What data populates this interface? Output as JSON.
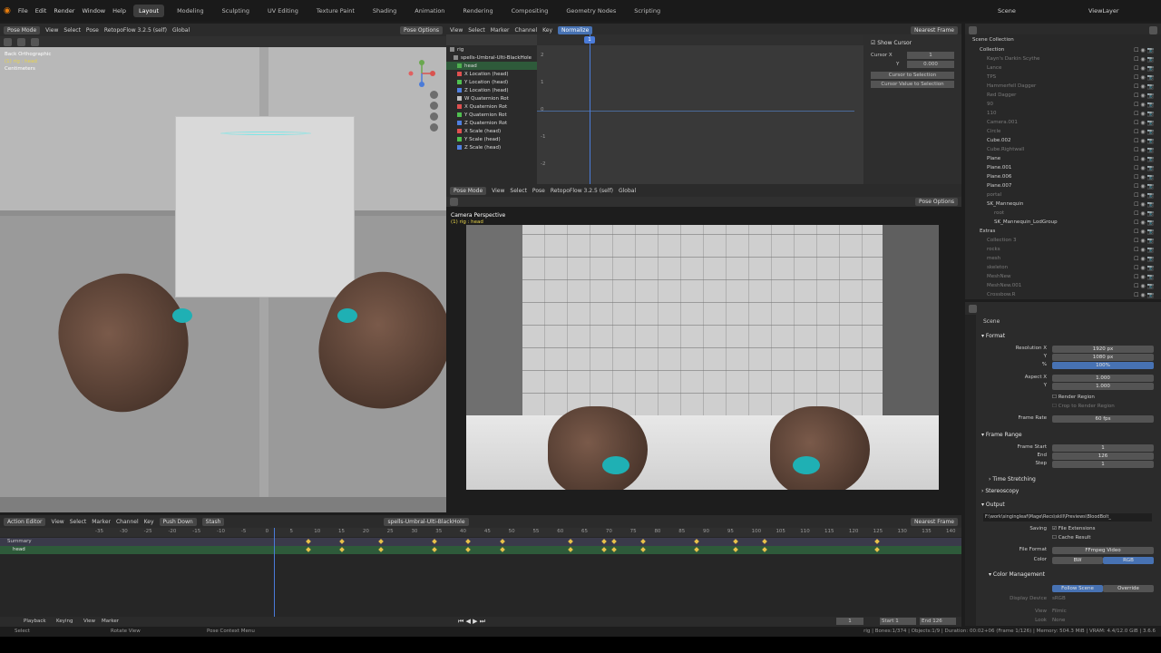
{
  "topbar": {
    "menus": [
      "File",
      "Edit",
      "Render",
      "Window",
      "Help"
    ],
    "workspaces": [
      "Layout",
      "Modeling",
      "Sculpting",
      "UV Editing",
      "Texture Paint",
      "Shading",
      "Animation",
      "Rendering",
      "Compositing",
      "Geometry Nodes",
      "Scripting"
    ],
    "active_workspace": "Layout",
    "scene": "Scene",
    "view_layer": "ViewLayer"
  },
  "viewport_left": {
    "mode": "Pose Mode",
    "menus": [
      "View",
      "Select",
      "Pose"
    ],
    "addon": "RetopoFlow 3.2.5 (self)",
    "transform": "Global",
    "pose_options": "Pose Options",
    "overlay_title": "Back Orthographic",
    "overlay_sub": "(1) rig : head",
    "overlay_unit": "Centimeters"
  },
  "graph_editor": {
    "menus": [
      "View",
      "Select",
      "Marker",
      "Channel",
      "Key"
    ],
    "normalize": "Normalize",
    "interp": "Nearest Frame",
    "ticks": [
      "-5",
      "0",
      "5",
      "10",
      "15",
      "20",
      "25",
      "30",
      "35",
      "40"
    ],
    "y_ticks": [
      "2",
      "1",
      "0",
      "-1",
      "-2"
    ],
    "current_frame": "1",
    "channels": [
      {
        "name": "rig",
        "color": "#8a8a8a"
      },
      {
        "name": "spells-Umbral-Ulti-BlackHole",
        "color": "#8a8a8a"
      },
      {
        "name": "head",
        "color": "#4fb04f"
      },
      {
        "name": "X Location (head)",
        "color": "#e05050"
      },
      {
        "name": "Y Location (head)",
        "color": "#50c050"
      },
      {
        "name": "Z Location (head)",
        "color": "#5080e0"
      },
      {
        "name": "W Quaternion Rot",
        "color": "#c0c0c0"
      },
      {
        "name": "X Quaternion Rot",
        "color": "#e05050"
      },
      {
        "name": "Y Quaternion Rot",
        "color": "#50c050"
      },
      {
        "name": "Z Quaternion Rot",
        "color": "#5080e0"
      },
      {
        "name": "X Scale (head)",
        "color": "#e05050"
      },
      {
        "name": "Y Scale (head)",
        "color": "#50c050"
      },
      {
        "name": "Z Scale (head)",
        "color": "#5080e0"
      }
    ]
  },
  "npanel": {
    "show_cursor": "Show Cursor",
    "cursor_x_label": "Cursor X",
    "cursor_x": "1",
    "y_label": "Y",
    "y_value": "0.000",
    "btn1": "Cursor to Selection",
    "btn2": "Cursor Value to Selection"
  },
  "camera_view": {
    "mode": "Pose Mode",
    "menus": [
      "View",
      "Select",
      "Pose"
    ],
    "addon": "RetopoFlow 3.2.5 (self)",
    "transform": "Global",
    "pose_options": "Pose Options",
    "title": "Camera Perspective",
    "sub": "(1) rig : head"
  },
  "outliner": {
    "title": "Scene Collection",
    "items": [
      {
        "name": "Collection",
        "level": 1,
        "dim": false
      },
      {
        "name": "Kayn's Darkin Scythe",
        "level": 2,
        "dim": true
      },
      {
        "name": "Lance",
        "level": 2,
        "dim": true
      },
      {
        "name": "TPS",
        "level": 2,
        "dim": true
      },
      {
        "name": "Hammerfell Dagger",
        "level": 2,
        "dim": true
      },
      {
        "name": "Red Dagger",
        "level": 2,
        "dim": true
      },
      {
        "name": "90",
        "level": 2,
        "dim": true
      },
      {
        "name": "110",
        "level": 2,
        "dim": true
      },
      {
        "name": "Camera.001",
        "level": 2,
        "dim": true
      },
      {
        "name": "Circle",
        "level": 2,
        "dim": true
      },
      {
        "name": "Cube.002",
        "level": 2,
        "dim": false
      },
      {
        "name": "Cube.Rightwall",
        "level": 2,
        "dim": true
      },
      {
        "name": "Plane",
        "level": 2,
        "dim": false
      },
      {
        "name": "Plane.001",
        "level": 2,
        "dim": false
      },
      {
        "name": "Plane.006",
        "level": 2,
        "dim": false
      },
      {
        "name": "Plane.007",
        "level": 2,
        "dim": false
      },
      {
        "name": "portal",
        "level": 2,
        "dim": true
      },
      {
        "name": "SK_Mannequin",
        "level": 2,
        "dim": false
      },
      {
        "name": "root",
        "level": 3,
        "dim": true
      },
      {
        "name": "SK_Mannequin_LodGroup",
        "level": 3,
        "dim": false
      },
      {
        "name": "Extras",
        "level": 1,
        "dim": false
      },
      {
        "name": "Collection 3",
        "level": 2,
        "dim": true
      },
      {
        "name": "rocks",
        "level": 2,
        "dim": true
      },
      {
        "name": "mesh",
        "level": 2,
        "dim": true
      },
      {
        "name": "skeleton",
        "level": 2,
        "dim": true
      },
      {
        "name": "MeshNew",
        "level": 2,
        "dim": true
      },
      {
        "name": "MeshNew.001",
        "level": 2,
        "dim": true
      },
      {
        "name": "Crossbow.R",
        "level": 2,
        "dim": true
      }
    ]
  },
  "properties": {
    "context": "Scene",
    "format_label": "Format",
    "res_x_label": "Resolution X",
    "res_x": "1920 px",
    "res_y_label": "Y",
    "res_y": "1080 px",
    "res_pct_label": "%",
    "res_pct": "100%",
    "aspect_x_label": "Aspect X",
    "aspect_x": "1.000",
    "aspect_y_label": "Y",
    "aspect_y": "1.000",
    "render_region": "Render Region",
    "crop": "Crop to Render Region",
    "frame_rate_label": "Frame Rate",
    "frame_rate": "60 fps",
    "frame_range_label": "Frame Range",
    "frame_start_label": "Frame Start",
    "frame_start": "1",
    "end_label": "End",
    "end": "126",
    "step_label": "Step",
    "step": "1",
    "time_stretching": "Time Stretching",
    "stereoscopy": "Stereoscopy",
    "output_label": "Output",
    "output_path": "F:\\work\\singingleaf\\Mage\\Recs\\skill\\Previews\\BloodBolt_",
    "saving_label": "Saving",
    "file_ext": "File Extensions",
    "cache_result": "Cache Result",
    "file_format_label": "File Format",
    "file_format": "FFmpeg Video",
    "color_label": "Color",
    "bw": "BW",
    "rgb": "RGB",
    "color_mgmt": "Color Management",
    "follow_scene": "Follow Scene",
    "override": "Override",
    "display_device_label": "Display Device",
    "display_device": "sRGB",
    "view_label": "View",
    "view_value": "Filmic",
    "look_label": "Look",
    "look_value": "None"
  },
  "action_editor": {
    "mode": "Action Editor",
    "menus": [
      "View",
      "Select",
      "Marker",
      "Channel",
      "Key"
    ],
    "push_down": "Push Down",
    "stash": "Stash",
    "action_name": "spells-Umbral-Ulti-BlackHole",
    "interp": "Nearest Frame",
    "ticks": [
      "-35",
      "-30",
      "-25",
      "-20",
      "-15",
      "-10",
      "-5",
      "0",
      "5",
      "10",
      "15",
      "20",
      "25",
      "30",
      "35",
      "40",
      "45",
      "50",
      "55",
      "60",
      "65",
      "70",
      "75",
      "80",
      "85",
      "90",
      "95",
      "100",
      "105",
      "110",
      "115",
      "120",
      "125",
      "130",
      "135",
      "140"
    ],
    "channels": [
      "Summary",
      "head"
    ],
    "current_frame": "1",
    "key_frames": [
      8,
      15,
      23,
      34,
      41,
      48,
      62,
      69,
      71,
      77,
      88,
      96,
      102,
      125
    ]
  },
  "timeline": {
    "menus": [
      "Playback",
      "Keying",
      "View",
      "Marker"
    ],
    "current": "1",
    "start_label": "Start",
    "start": "1",
    "end_label": "End",
    "end": "126"
  },
  "statusbar": {
    "select": "Select",
    "rotate": "Rotate View",
    "context": "Pose Context Menu",
    "stats": "rig | Bones:1/374 | Objects:1/9 | Duration: 00:02+06 (Frame 1/126) | Memory: 504.3 MiB | VRAM: 4.4/12.0 GiB | 3.6.6"
  }
}
